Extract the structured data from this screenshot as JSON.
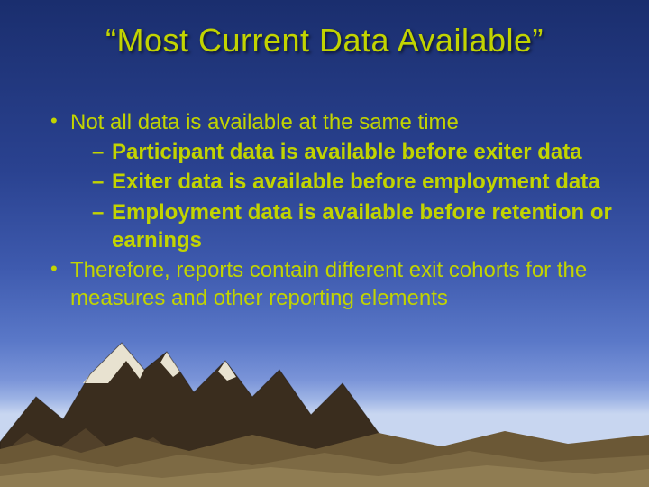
{
  "slide": {
    "title": "“Most Current Data Available”",
    "bullets": {
      "b1a": "Not all data is available at the same time",
      "b2a": "Participant data is available before exiter data",
      "b2b": "Exiter data is available before employment data",
      "b2c": "Employment data is available before retention or earnings",
      "b1b": "Therefore, reports contain different exit cohorts for the measures and other reporting elements"
    }
  }
}
